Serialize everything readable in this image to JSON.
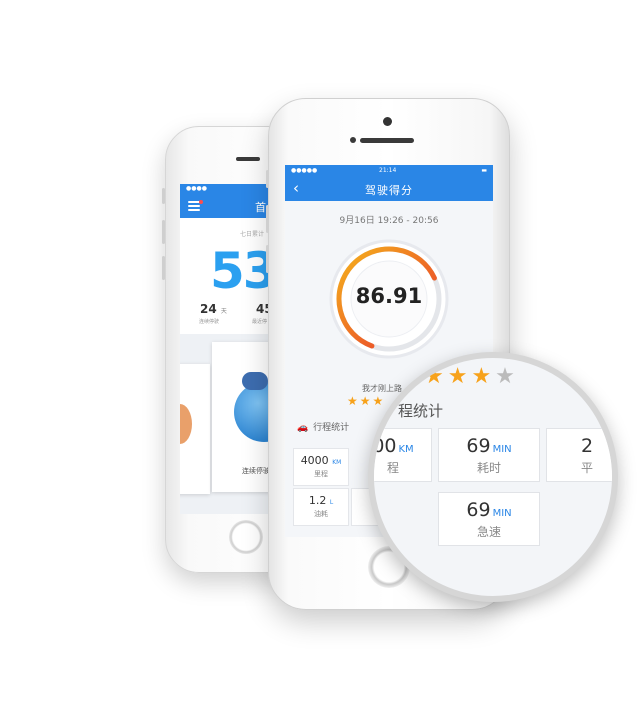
{
  "back_phone": {
    "status": "●●●●",
    "nav_title": "首",
    "subtitle": "七日累计",
    "big_number": "53",
    "stat_days": "24",
    "stat_days_unit": "天",
    "stat_days_label": "连续停驶",
    "stat_two": "45",
    "stat_two_label": "最近停",
    "card_label": "连续停驶",
    "pager": "• • •"
  },
  "front_phone": {
    "status_left": "●●●●● ",
    "status_time": "21:14",
    "status_right": "▬",
    "nav_back": "‹",
    "nav_title": "驾驶得分",
    "date_line": "9月16日  19:26 - 20:56",
    "score": "86.91",
    "score_fraction": 0.8691,
    "message": "我才刚上路",
    "stars": "★★★",
    "section_icon": "🚗",
    "section_title": "行程统计",
    "stats": [
      {
        "value": "4000",
        "unit": "KM",
        "label": "里程"
      },
      {
        "value": "1.2",
        "unit": "L",
        "label": "油耗"
      },
      {
        "value": "6",
        "unit": "",
        "label": "急"
      }
    ]
  },
  "magnifier": {
    "stars_filled": "★★★",
    "stars_empty": "★",
    "section_title": "程统计",
    "cells": [
      {
        "value": "00",
        "unit": "KM",
        "label": "程"
      },
      {
        "value": "69",
        "unit": "MIN",
        "label": "耗时"
      },
      {
        "value": "2",
        "unit": "",
        "label": "平"
      },
      {
        "value": "69",
        "unit": "MIN",
        "label": "急速"
      }
    ]
  },
  "colors": {
    "accent_blue": "#2a86e6",
    "star_orange": "#f7a21b",
    "gauge_yellow": "#f5b31c",
    "gauge_red": "#e8322d"
  }
}
